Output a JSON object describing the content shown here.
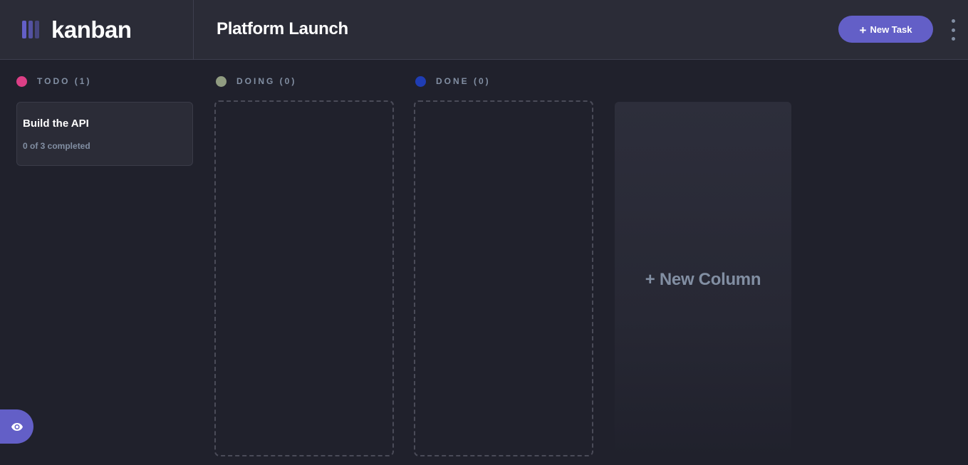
{
  "brand": {
    "name": "kanban"
  },
  "header": {
    "board_title": "Platform Launch",
    "new_task_plus": "+",
    "new_task_label": "New Task"
  },
  "columns": [
    {
      "label": "TODO (1)",
      "color": "#dc3f86"
    },
    {
      "label": "DOING (0)",
      "color": "#909c81"
    },
    {
      "label": "DONE (0)",
      "color": "#1f3db4"
    }
  ],
  "tasks": [
    {
      "title": "Build the API",
      "subtasks": "0 of 3 completed"
    }
  ],
  "new_column_label": "+ New Column",
  "icons": {
    "logo": "kanban-logo-icon",
    "menu": "vertical-ellipsis-icon",
    "sidebar_toggle": "eye-icon"
  },
  "colors": {
    "accent": "#635fc7",
    "background": "#20212c",
    "surface": "#2b2c37",
    "muted_text": "#828fa3"
  }
}
